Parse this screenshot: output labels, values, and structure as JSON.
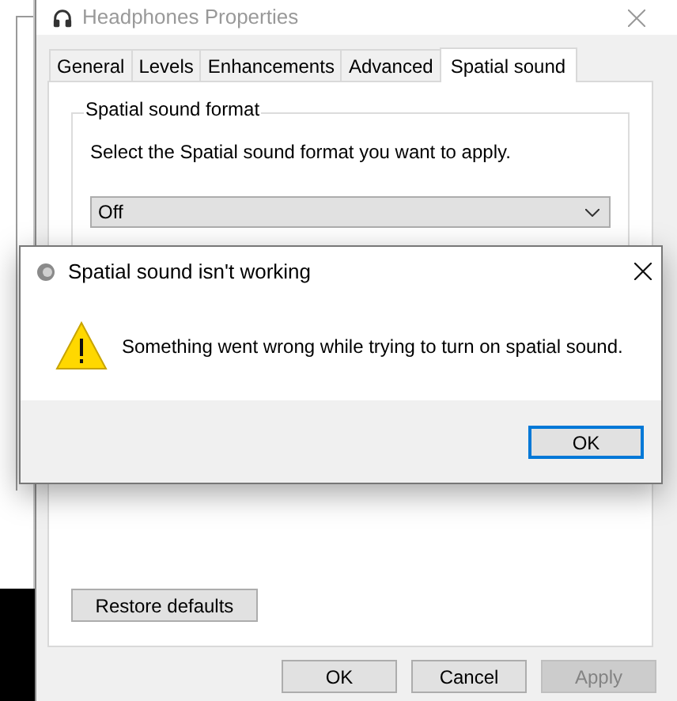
{
  "window": {
    "title": "Headphones Properties"
  },
  "tabs": [
    {
      "label": "General",
      "selected": false
    },
    {
      "label": "Levels",
      "selected": false
    },
    {
      "label": "Enhancements",
      "selected": false
    },
    {
      "label": "Advanced",
      "selected": false
    },
    {
      "label": "Spatial sound",
      "selected": true
    }
  ],
  "group": {
    "title": "Spatial sound format",
    "description": "Select the Spatial sound format you want to apply.",
    "dropdown": {
      "value": "Off"
    }
  },
  "restore_button": "Restore defaults",
  "buttons": [
    {
      "label": "OK",
      "disabled": false
    },
    {
      "label": "Cancel",
      "disabled": false
    },
    {
      "label": "Apply",
      "disabled": true
    }
  ],
  "dialog": {
    "title": "Spatial sound isn't working",
    "message": "Something went wrong while trying to turn on spatial sound.",
    "button": "OK"
  }
}
